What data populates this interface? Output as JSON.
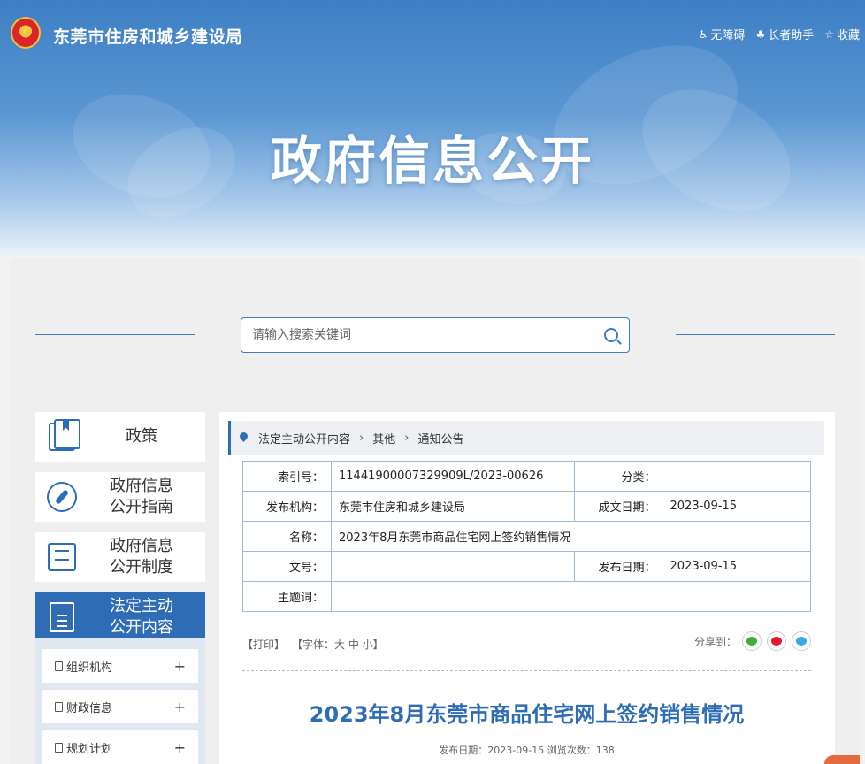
{
  "header": {
    "site_title": "东莞市住房和城乡建设局",
    "banner_title": "政府信息公开",
    "tools": [
      {
        "icon": "accessibility-icon",
        "label": "无障碍"
      },
      {
        "icon": "elder-assist-icon",
        "label": "长者助手"
      },
      {
        "icon": "star-icon",
        "label": "收藏"
      }
    ]
  },
  "search": {
    "placeholder": "请输入搜索关键词"
  },
  "sidebar": {
    "items": [
      {
        "label": "政策",
        "icon": "book-icon"
      },
      {
        "label": "政府信息公开指南",
        "line1": "政府信息",
        "line2": "公开指南",
        "icon": "compass-icon"
      },
      {
        "label": "政府信息公开制度",
        "line1": "政府信息",
        "line2": "公开制度",
        "icon": "list-icon"
      },
      {
        "label": "法定主动公开内容",
        "line1": "法定主动",
        "line2": "公开内容",
        "icon": "document-icon",
        "active": true
      }
    ],
    "sub_items": [
      {
        "label": "组织机构",
        "toggle": "+"
      },
      {
        "label": "财政信息",
        "toggle": "+"
      },
      {
        "label": "规划计划",
        "toggle": "+"
      }
    ]
  },
  "breadcrumb": [
    "法定主动公开内容",
    "其他",
    "通知公告"
  ],
  "meta_table": {
    "index_label": "索引号：",
    "index_value": "11441900007329909L/2023-00626",
    "category_label": "分类：",
    "category_value": "",
    "publisher_label": "发布机构：",
    "publisher_value": "东莞市住房和城乡建设局",
    "created_label": "成文日期：",
    "created_value": "2023-09-15",
    "name_label": "名称：",
    "name_value": "2023年8月东莞市商品住宅网上签约销售情况",
    "docno_label": "文号：",
    "docno_value": "",
    "published_label": "发布日期：",
    "published_value": "2023-09-15",
    "subject_label": "主题词：",
    "subject_value": ""
  },
  "toolbar": {
    "print": "【打印】",
    "font_size": "【字体：大  中  小】",
    "share_label": "分享到：",
    "share_buttons": [
      {
        "icon": "wechat-icon",
        "color": "#3cb034"
      },
      {
        "icon": "weibo-icon",
        "color": "#e6162d"
      },
      {
        "icon": "qq-icon",
        "color": "#3aa7e8"
      }
    ]
  },
  "article": {
    "title": "2023年8月东莞市商品住宅网上签约销售情况",
    "meta": "发布日期：2023-09-15   浏览次数：138"
  }
}
